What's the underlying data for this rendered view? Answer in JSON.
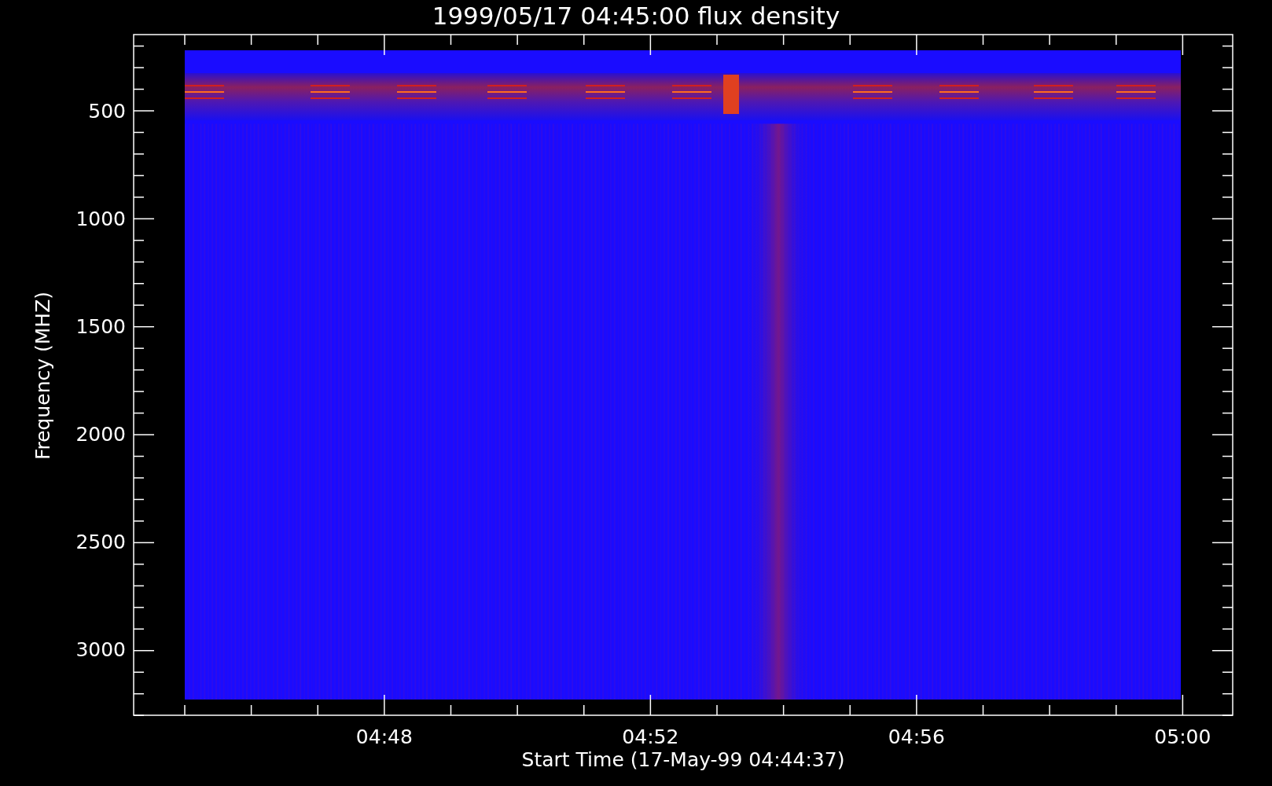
{
  "title": "1999/05/17 04:45:00 flux density",
  "y_axis": {
    "label": "Frequency (MHZ)",
    "tick_labels": [
      "500",
      "1000",
      "1500",
      "2000",
      "2500",
      "3000"
    ]
  },
  "x_axis": {
    "label": "Start Time (17-May-99 04:44:37)",
    "tick_labels": [
      "04:48",
      "04:52",
      "04:56",
      "05:00"
    ]
  }
}
